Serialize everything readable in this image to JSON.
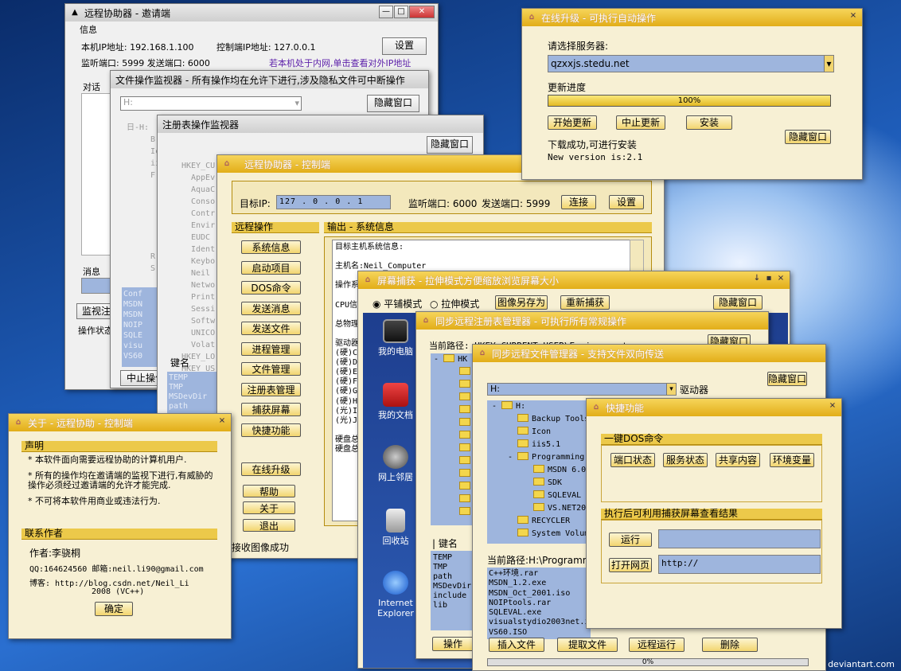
{
  "invite": {
    "title": "远程协助器 - 邀请端",
    "info": "信息",
    "local_ip": "本机IP地址: 192.168.1.100",
    "ctrl_ip": "控制端IP地址: 127.0.0.1",
    "setup": "设置",
    "ports": "监听端口: 5999 发送端口: 6000",
    "intranet_link": "若本机处于内网,单击查看对外IP地址",
    "dialog": "对话",
    "msg": "消息",
    "monitor_btn": "监视注册",
    "op_status": "操作状态",
    "stop_btn": "中止操作"
  },
  "filemon": {
    "title": "文件操作监视器 - 所有操作均在允许下进行,涉及隐私文件可中断操作",
    "drive": "H:",
    "hide": "隐藏窗口",
    "tree": [
      "日-H:",
      "B",
      "Ic",
      "ii",
      "F",
      "R",
      "S"
    ],
    "blue_items": [
      "Conf",
      "MSDN",
      "MSDN",
      "NOIP",
      "SQLE",
      "visu",
      "VS60"
    ]
  },
  "regmon": {
    "title": "注册表操作监视器",
    "hide": "隐藏窗口",
    "tree": [
      "HKEY_CU",
      "AppEv",
      "AquaC",
      "Conso",
      "Contr",
      "Envir",
      "EUDC",
      "Ident",
      "Keybo",
      "Neil",
      "Netwo",
      "Print",
      "Sessi",
      "Softw",
      "UNICO",
      "Volat",
      "HKEY_LO",
      "HKEY_US",
      "HKEY_CU"
    ],
    "key_label": "键名",
    "keys": [
      "TEMP",
      "TMP",
      "MSDevDir",
      "path"
    ]
  },
  "control": {
    "title": "远程协助器 - 控制端",
    "target_label": "目标IP:",
    "ip": [
      "127",
      "0",
      "0",
      "1"
    ],
    "listen": "监听端口: 6000",
    "send": "发送端口: 5999",
    "connect": "连接",
    "setup": "设置",
    "remote_ops": "远程操作",
    "buttons": [
      "系统信息",
      "启动项目",
      "DOS命令",
      "发送消息",
      "发送文件",
      "进程管理",
      "文件管理",
      "注册表管理",
      "捕获屏幕",
      "快捷功能"
    ],
    "upgrade": "在线升级",
    "help": "帮助",
    "about": "关于",
    "exit": "退出",
    "output": "输出 - 系统信息",
    "sys_lines": [
      "目标主机系统信息:",
      "",
      "主机名:Neil_Computer",
      "",
      "操作系",
      "",
      "CPU信",
      "",
      "总物理",
      "",
      "驱动器",
      "(硬)C",
      "(硬)D",
      "(硬)E",
      "(硬)F",
      "(硬)G",
      "(硬)H",
      "(光)I",
      "(光)J",
      "",
      "硬盘总",
      "硬盘总"
    ],
    "status": "接收图像成功"
  },
  "upgrade": {
    "title": "在线升级 - 可执行自动操作",
    "choose": "请选择服务器:",
    "server": "qzxxjs.stedu.net",
    "progress_label": "更新进度",
    "progress": "100%",
    "progress_value": 100,
    "start": "开始更新",
    "stop": "中止更新",
    "install": "安装",
    "hide": "隐藏窗口",
    "done": "下载成功,可进行安装",
    "version": "New version is:2.1"
  },
  "about": {
    "title": "关于 - 远程协助 - 控制端",
    "decl": "声明",
    "lines": [
      "* 本软件面向需要远程协助的计算机用户.",
      "* 所有的操作均在邀请端的监视下进行,有威胁的操作必须经过邀请端的允许才能完成.",
      "* 不可将本软件用商业或违法行为."
    ],
    "contact": "联系作者",
    "author": "作者:李骁桐",
    "qq": "QQ:164624560 邮箱:neil.li90@gmail.com",
    "blog": "博客: http://blog.csdn.net/Neil_Li",
    "year": "2008 (VC++)",
    "ok": "确定"
  },
  "screen": {
    "title": "屏幕捕获 - 拉伸模式方便缩放浏览屏幕大小",
    "tile": "平铺模式",
    "stretch": "拉伸模式",
    "save": "图像另存为",
    "recapture": "重新捕获",
    "hide": "隐藏窗口",
    "icons": [
      "我的电脑",
      "我的文档",
      "网上邻居",
      "回收站",
      "Internet Explorer"
    ]
  },
  "regmgr": {
    "title": "同步远程注册表管理器 - 可执行所有常规操作",
    "path": "当前路径: HKEY_CURRENT_USER\\Environment",
    "hide": "隐藏窗口",
    "key_label": "键名",
    "keys": [
      "TEMP",
      "TMP",
      "path",
      "MSDevDir",
      "include",
      "lib"
    ],
    "op": "操作"
  },
  "filemgr": {
    "title": "同步远程文件管理器 - 支持文件双向传送",
    "hide": "隐藏窗口",
    "drive": "H:",
    "drive_label": "驱动器",
    "tree": [
      "H:",
      "Backup Tools",
      "Icon",
      "iis5.1",
      "Programming",
      "MSDN 6.0",
      "SDK",
      "SQLEVAL",
      "VS.NET2003",
      "RECYCLER",
      "System Volume"
    ],
    "path": "当前路径:H:\\Programming",
    "files": [
      "C++环境.rar",
      "MSDN_1.2.exe",
      "MSDN_Oct_2001.iso",
      "NOIPtools.rar",
      "SQLEVAL.exe",
      "visualstydio2003net.iso",
      "VS60.ISO"
    ],
    "insert": "插入文件",
    "extract": "提取文件",
    "run": "远程运行",
    "delete": "删除",
    "progress": "0%"
  },
  "quick": {
    "title": "快捷功能",
    "dos": "一键DOS命令",
    "dos_btns": [
      "端口状态",
      "服务状态",
      "共享内容",
      "环境变量"
    ],
    "result": "执行后可利用捕获屏幕查看结果",
    "run": "运行",
    "open": "打开网页",
    "url": "http://"
  },
  "watermark": "deviantart.com"
}
